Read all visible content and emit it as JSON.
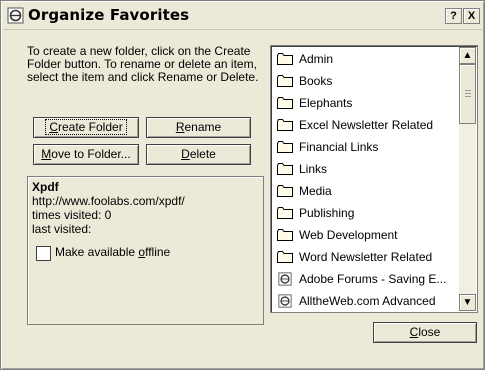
{
  "window": {
    "title": "Organize Favorites",
    "help_button": "?",
    "close_button": "X"
  },
  "instructions": "To create a new folder, click on the Create Folder button. To rename or delete an item, select the item and click Rename or Delete.",
  "buttons": {
    "create_folder": {
      "first": "C",
      "rest": "reate Folder"
    },
    "rename": {
      "first": "R",
      "rest": "ename"
    },
    "move_to_folder": {
      "first": "M",
      "rest": "ove to Folder..."
    },
    "delete": {
      "first": "D",
      "rest": "elete"
    },
    "close": {
      "first": "C",
      "rest": "lose"
    }
  },
  "info": {
    "name": "Xpdf",
    "url": "http://www.foolabs.com/xpdf/",
    "times_visited": "times visited: 0",
    "last_visited": "last visited:",
    "offline_label_pre": "Make available ",
    "offline_label_under": "o",
    "offline_label_post": "ffline"
  },
  "favorites": [
    {
      "label": "Admin",
      "icon": "folder-icon"
    },
    {
      "label": "Books",
      "icon": "folder-icon"
    },
    {
      "label": "Elephants",
      "icon": "folder-icon"
    },
    {
      "label": "Excel Newsletter Related",
      "icon": "folder-icon"
    },
    {
      "label": "Financial Links",
      "icon": "folder-icon"
    },
    {
      "label": "Links",
      "icon": "folder-icon"
    },
    {
      "label": "Media",
      "icon": "folder-icon"
    },
    {
      "label": "Publishing",
      "icon": "folder-icon"
    },
    {
      "label": "Web Development",
      "icon": "folder-icon"
    },
    {
      "label": "Word Newsletter Related",
      "icon": "folder-icon"
    },
    {
      "label": "Adobe Forums - Saving E...",
      "icon": "ie-page-icon"
    },
    {
      "label": "AlltheWeb.com Advanced",
      "icon": "ie-page-icon"
    }
  ],
  "scroll": {
    "up": "▲",
    "down": "▼"
  }
}
